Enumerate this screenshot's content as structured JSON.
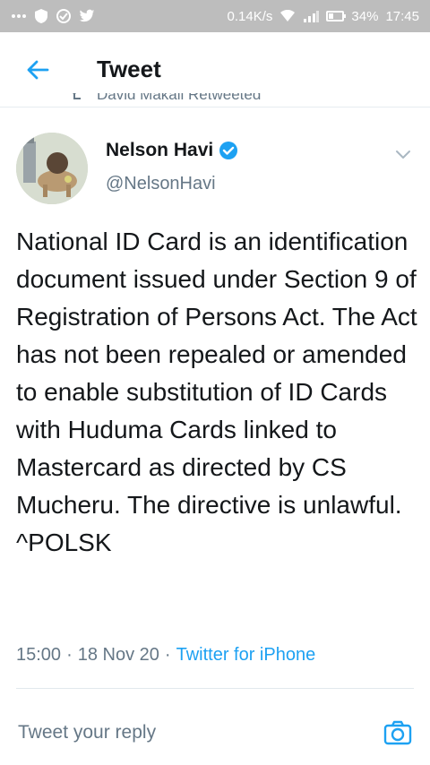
{
  "status_bar": {
    "left_icons": [
      "more-dots",
      "shield",
      "circle-check",
      "twitter-bird"
    ],
    "speed": "0.14K/s",
    "battery": "34%",
    "time": "17:45"
  },
  "header": {
    "title": "Tweet"
  },
  "retweet": {
    "text": "David Makali Retweeted"
  },
  "author": {
    "name": "Nelson Havi",
    "handle": "@NelsonHavi"
  },
  "tweet": {
    "text": "National ID Card is an identification document issued under Section 9 of Registration of Persons Act. The Act has not been repealed or amended to enable substitution of ID Cards with Huduma Cards linked to Mastercard as directed by CS Mucheru. The directive is unlawful. ^POLSK",
    "time": "15:00",
    "date": "18 Nov 20",
    "source": "Twitter for iPhone",
    "sep": "·"
  },
  "reply": {
    "placeholder": "Tweet your reply"
  },
  "colors": {
    "accent": "#1da1f2",
    "secondary_text": "#657786",
    "status_bar": "#bdbdbd"
  }
}
